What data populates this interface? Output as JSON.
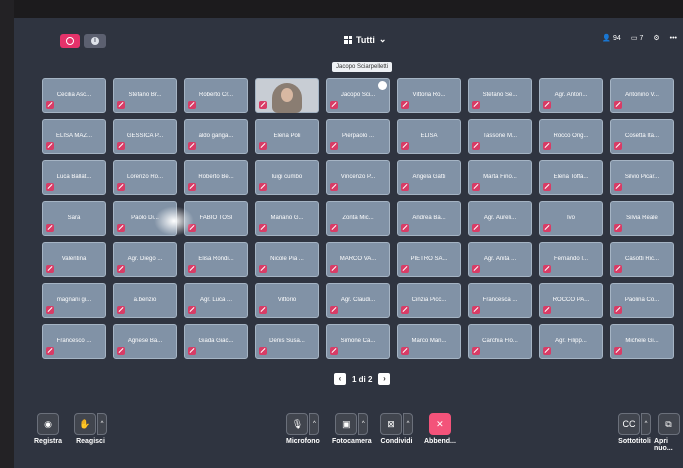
{
  "topbar": {
    "view_label": "Tutti",
    "participants_count": "94",
    "chat_count": "7"
  },
  "tooltip": "Jacopo Sciarpelletti",
  "tiles": [
    "Cecilia Asc...",
    "Stefano Br...",
    "Roberto Cr...",
    "",
    "Jacopo Sci...",
    "Vittoria Ro...",
    "Stefano Se...",
    "Agr. Anton...",
    "Antonino V...",
    "ELISA MAZ...",
    "GESSICA P...",
    "aldo ganga...",
    "Elena Poli",
    "Pierpaolo ...",
    "ELISA",
    "Tassone M...",
    "Rocco Orig...",
    "Cosetta Ita...",
    "Luca Ballat...",
    "Lorenzo Ro...",
    "Roberto Be...",
    "luigi cumbo",
    "Vincenzo P...",
    "Angela Gatti",
    "Marta Fino...",
    "Elena Toffa...",
    "Silvio Picar...",
    "Sara",
    "Paolo Di...",
    "FABIO TOSI",
    "Mariano G...",
    "Zonta Mic...",
    "Andrea Ba...",
    "Agr. Aureli...",
    "Ivo",
    "Silvia Reale",
    "Valentina",
    "Agr. Diego ...",
    "Elisa Rondi...",
    "Nicole Pia ...",
    "MARCO VA...",
    "PIETRO SA...",
    "Agr. Anita ...",
    "Fernando I...",
    "Casotti Ric...",
    "magnani gi...",
    "a.benzio",
    "Agr. Luca ...",
    "Vittorio",
    "Agr. Claudi...",
    "Cinzia Picc...",
    "Francesca ...",
    "ROCCO PA...",
    "Paolina Co...",
    "Francesco ...",
    "Agnese Ba...",
    "Giada Giac...",
    "Denis Susa...",
    "Simone Ca...",
    "Marco Man...",
    "Carchia Flo...",
    "Agr. Filipp...",
    "Michele Gi..."
  ],
  "pager": {
    "label": "1 di 2"
  },
  "bottom": {
    "registra": "Registra",
    "reagisci": "Reagisci",
    "microfono": "Microfono",
    "fotocamera": "Fotocamera",
    "condividi": "Condividi",
    "abbandona": "Abbend...",
    "sottotitoli": "Sottotitoli",
    "apri_nuovo": "Apri nuo..."
  }
}
